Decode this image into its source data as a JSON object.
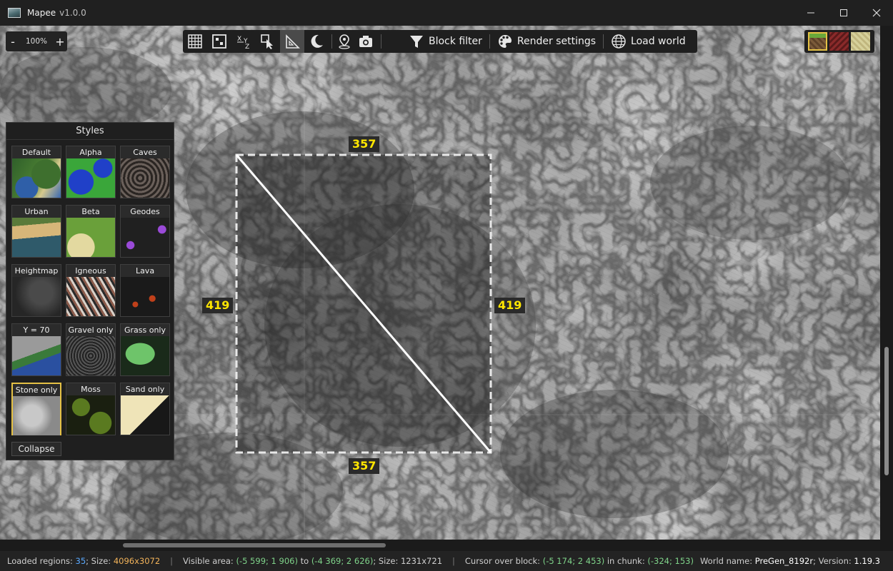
{
  "window": {
    "title": "Mapee",
    "version": "v1.0.0",
    "minimize_icon": "minimize-icon",
    "maximize_icon": "maximize-icon",
    "close_icon": "close-icon"
  },
  "zoom": {
    "minus": "-",
    "value": "100%",
    "plus": "+"
  },
  "toolbar": {
    "icons": [
      "grid-icon",
      "chunk-icon",
      "xyz-icon",
      "select-cursor-icon",
      "ruler-triangle-icon",
      "moon-icon",
      "map-pin-icon",
      "camera-icon"
    ],
    "active": "ruler-triangle-icon",
    "block_filter": "Block filter",
    "render_settings": "Render settings",
    "load_world": "Load world"
  },
  "swatches": {
    "colors": [
      "#7a5a3a",
      "#8a2a2a",
      "#d6d09a"
    ],
    "selected_index": 0
  },
  "styles": {
    "title": "Styles",
    "items": [
      {
        "label": "Default"
      },
      {
        "label": "Alpha"
      },
      {
        "label": "Caves"
      },
      {
        "label": "Urban"
      },
      {
        "label": "Beta"
      },
      {
        "label": "Geodes"
      },
      {
        "label": "Heightmap"
      },
      {
        "label": "Igneous"
      },
      {
        "label": "Lava"
      },
      {
        "label": "Y = 70"
      },
      {
        "label": "Gravel only"
      },
      {
        "label": "Grass only"
      },
      {
        "label": "Stone only"
      },
      {
        "label": "Moss"
      },
      {
        "label": "Sand only"
      }
    ],
    "selected": "Stone only",
    "collapse": "Collapse"
  },
  "measure": {
    "top": "357",
    "bottom": "357",
    "left": "419",
    "right": "419"
  },
  "status": {
    "loaded_regions_label": "Loaded regions: ",
    "loaded_regions": "35",
    "size_label": "; Size: ",
    "size": "4096x3072",
    "sep": "|",
    "visible_label": "Visible area: ",
    "visible_from": "(-5 599; 1 906)",
    "to_label": " to ",
    "visible_to": "(-4 369; 2 626)",
    "vsize_label": "; Size: ",
    "vsize": "1231x721",
    "cursor_label": "Cursor over block: ",
    "cursor_block": "(-5 174; 2 453)",
    "chunk_label": " in chunk: ",
    "chunk": "(-324; 153)",
    "world_label": "World name: ",
    "world": "PreGen_8192r",
    "version_label": "; Version: ",
    "version": "1.19.3"
  }
}
